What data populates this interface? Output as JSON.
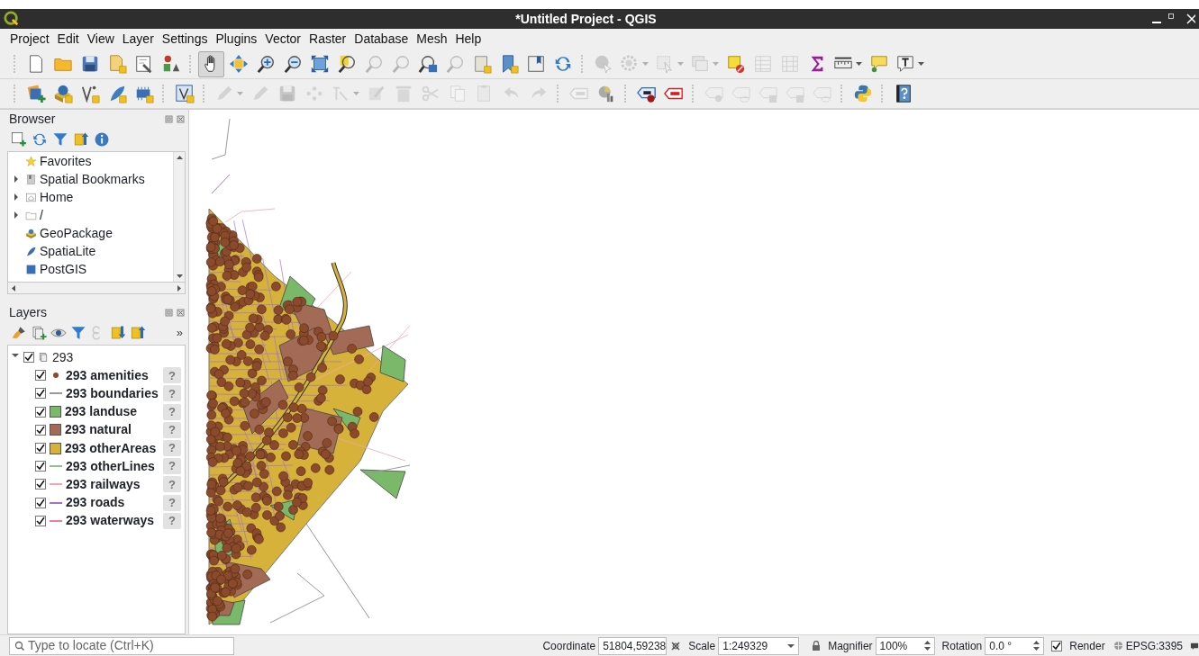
{
  "window": {
    "title": "*Untitled Project - QGIS"
  },
  "menu": [
    "Project",
    "Edit",
    "View",
    "Layer",
    "Settings",
    "Plugins",
    "Vector",
    "Raster",
    "Database",
    "Mesh",
    "Help"
  ],
  "toolbars": [
    {
      "items": [
        {
          "kind": "tool",
          "disabled": false,
          "pressed": false,
          "menu": false
        },
        {
          "kind": "tool",
          "disabled": false,
          "pressed": false,
          "menu": false
        },
        {
          "kind": "tool",
          "disabled": false,
          "pressed": false,
          "menu": false
        },
        {
          "kind": "tool",
          "disabled": false,
          "pressed": false,
          "menu": false
        },
        {
          "kind": "tool",
          "disabled": false,
          "pressed": false,
          "menu": false
        },
        {
          "kind": "tool",
          "disabled": false,
          "pressed": false,
          "menu": false
        },
        {
          "kind": "separator"
        },
        {
          "kind": "tool",
          "disabled": false,
          "pressed": true,
          "menu": false
        },
        {
          "kind": "tool",
          "disabled": false,
          "pressed": false,
          "menu": false
        },
        {
          "kind": "tool",
          "disabled": false,
          "pressed": false,
          "menu": false
        },
        {
          "kind": "tool",
          "disabled": false,
          "pressed": false,
          "menu": false
        },
        {
          "kind": "tool",
          "disabled": false,
          "pressed": false,
          "menu": false
        },
        {
          "kind": "tool",
          "disabled": false,
          "pressed": false,
          "menu": false
        },
        {
          "kind": "tool",
          "disabled": true,
          "pressed": false,
          "menu": false
        },
        {
          "kind": "tool",
          "disabled": true,
          "pressed": false,
          "menu": false
        },
        {
          "kind": "tool",
          "disabled": false,
          "pressed": false,
          "menu": false
        },
        {
          "kind": "tool",
          "disabled": true,
          "pressed": false,
          "menu": false
        },
        {
          "kind": "tool",
          "disabled": false,
          "pressed": false,
          "menu": false
        },
        {
          "kind": "tool",
          "disabled": false,
          "pressed": false,
          "menu": false
        },
        {
          "kind": "tool",
          "disabled": false,
          "pressed": false,
          "menu": false
        },
        {
          "kind": "tool",
          "disabled": false,
          "pressed": false,
          "menu": false
        },
        {
          "kind": "separator"
        },
        {
          "kind": "tool",
          "disabled": true,
          "pressed": false,
          "menu": false
        },
        {
          "kind": "tool",
          "disabled": true,
          "pressed": false,
          "menu": true
        },
        {
          "kind": "tool",
          "disabled": true,
          "pressed": false,
          "menu": true
        },
        {
          "kind": "tool",
          "disabled": true,
          "pressed": false,
          "menu": true
        },
        {
          "kind": "tool",
          "disabled": false,
          "pressed": false,
          "menu": false
        },
        {
          "kind": "tool",
          "disabled": true,
          "pressed": false,
          "menu": false
        },
        {
          "kind": "tool",
          "disabled": true,
          "pressed": false,
          "menu": false
        },
        {
          "kind": "tool",
          "disabled": false,
          "pressed": false,
          "menu": false
        },
        {
          "kind": "tool",
          "disabled": false,
          "pressed": false,
          "menu": true
        },
        {
          "kind": "tool",
          "disabled": false,
          "pressed": false,
          "menu": false
        },
        {
          "kind": "tool",
          "disabled": false,
          "pressed": false,
          "menu": true
        }
      ]
    },
    {
      "items": [
        {
          "kind": "tool",
          "disabled": false,
          "pressed": false,
          "menu": false
        },
        {
          "kind": "tool",
          "disabled": false,
          "pressed": false,
          "menu": false
        },
        {
          "kind": "tool",
          "disabled": false,
          "pressed": false,
          "menu": false
        },
        {
          "kind": "tool",
          "disabled": false,
          "pressed": false,
          "menu": false
        },
        {
          "kind": "tool",
          "disabled": false,
          "pressed": false,
          "menu": false
        },
        {
          "kind": "separator"
        },
        {
          "kind": "tool",
          "disabled": false,
          "pressed": false,
          "menu": false
        },
        {
          "kind": "separator"
        },
        {
          "kind": "tool",
          "disabled": true,
          "pressed": false,
          "menu": true
        },
        {
          "kind": "tool",
          "disabled": true,
          "pressed": false,
          "menu": false
        },
        {
          "kind": "tool",
          "disabled": true,
          "pressed": false,
          "menu": false
        },
        {
          "kind": "tool",
          "disabled": true,
          "pressed": false,
          "menu": false
        },
        {
          "kind": "tool",
          "disabled": true,
          "pressed": false,
          "menu": true
        },
        {
          "kind": "tool",
          "disabled": true,
          "pressed": false,
          "menu": false
        },
        {
          "kind": "tool",
          "disabled": true,
          "pressed": false,
          "menu": false
        },
        {
          "kind": "tool",
          "disabled": true,
          "pressed": false,
          "menu": false
        },
        {
          "kind": "tool",
          "disabled": true,
          "pressed": false,
          "menu": false
        },
        {
          "kind": "tool",
          "disabled": true,
          "pressed": false,
          "menu": false
        },
        {
          "kind": "tool",
          "disabled": true,
          "pressed": false,
          "menu": false
        },
        {
          "kind": "tool",
          "disabled": true,
          "pressed": false,
          "menu": false
        },
        {
          "kind": "separator"
        },
        {
          "kind": "tool",
          "disabled": true,
          "pressed": false,
          "menu": false
        },
        {
          "kind": "tool",
          "disabled": false,
          "pressed": false,
          "menu": false
        },
        {
          "kind": "separator"
        },
        {
          "kind": "tool",
          "disabled": false,
          "pressed": false,
          "menu": false
        },
        {
          "kind": "tool",
          "disabled": false,
          "pressed": false,
          "menu": false
        },
        {
          "kind": "separator"
        },
        {
          "kind": "tool",
          "disabled": true,
          "pressed": false,
          "menu": false
        },
        {
          "kind": "tool",
          "disabled": true,
          "pressed": false,
          "menu": false
        },
        {
          "kind": "tool",
          "disabled": true,
          "pressed": false,
          "menu": false
        },
        {
          "kind": "tool",
          "disabled": true,
          "pressed": false,
          "menu": false
        },
        {
          "kind": "tool",
          "disabled": true,
          "pressed": false,
          "menu": false
        },
        {
          "kind": "separator"
        },
        {
          "kind": "tool",
          "disabled": false,
          "pressed": false,
          "menu": false
        },
        {
          "kind": "separator"
        },
        {
          "kind": "tool",
          "disabled": false,
          "pressed": false,
          "menu": false
        }
      ]
    }
  ],
  "browser": {
    "title": "Browser",
    "toolbar": [
      {
        "disabled": false
      },
      {
        "disabled": false
      },
      {
        "disabled": false
      },
      {
        "disabled": false
      },
      {
        "disabled": false
      }
    ],
    "items": [
      {
        "label": "Favorites",
        "collapsed": false
      },
      {
        "label": "Spatial Bookmarks",
        "collapsed": true
      },
      {
        "label": "Home",
        "collapsed": true
      },
      {
        "label": "/",
        "collapsed": true
      },
      {
        "label": "GeoPackage",
        "collapsed": false
      },
      {
        "label": "SpatiaLite",
        "collapsed": false
      },
      {
        "label": "PostGIS",
        "collapsed": false
      }
    ]
  },
  "layers": {
    "title": "Layers",
    "toolbar": [
      {
        "disabled": false
      },
      {
        "disabled": false
      },
      {
        "disabled": false
      },
      {
        "disabled": false
      },
      {
        "disabled": true
      },
      {
        "disabled": false
      },
      {
        "disabled": false
      }
    ],
    "more": "»",
    "group": {
      "name": "293",
      "checked": true,
      "expanded": true,
      "children": [
        {
          "name": "293 amenities",
          "checked": true,
          "kind": "point",
          "color": "#8b4a2b",
          "indicator": "?"
        },
        {
          "name": "293 boundaries",
          "checked": true,
          "kind": "line",
          "color": "#9a9a9a",
          "indicator": "?"
        },
        {
          "name": "293 landuse",
          "checked": true,
          "kind": "fill",
          "color": "#7ab86a",
          "indicator": "?"
        },
        {
          "name": "293 natural",
          "checked": true,
          "kind": "fill",
          "color": "#a36b55",
          "indicator": "?"
        },
        {
          "name": "293 otherAreas",
          "checked": true,
          "kind": "fill",
          "color": "#d6b23a",
          "indicator": "?"
        },
        {
          "name": "293 otherLines",
          "checked": true,
          "kind": "line",
          "color": "#8fc08f",
          "indicator": "?"
        },
        {
          "name": "293 railways",
          "checked": true,
          "kind": "line",
          "color": "#f2a6b6",
          "indicator": "?"
        },
        {
          "name": "293 roads",
          "checked": true,
          "kind": "line",
          "color": "#a474c4",
          "indicator": "?"
        },
        {
          "name": "293 waterways",
          "checked": true,
          "kind": "line",
          "color": "#e8809a",
          "indicator": "?"
        }
      ]
    }
  },
  "status_bar": {
    "locate_placeholder": "Type to locate (Ctrl+K)",
    "coordinate_label": "Coordinate",
    "coordinate": "51804,59238",
    "scale_label": "Scale",
    "scale": "1:249329",
    "magnifier_label": "Magnifier",
    "magnifier": "100%",
    "rotation_label": "Rotation",
    "rotation": "0.0 °",
    "render_label": "Render",
    "render": true,
    "crs": "EPSG:3395"
  }
}
